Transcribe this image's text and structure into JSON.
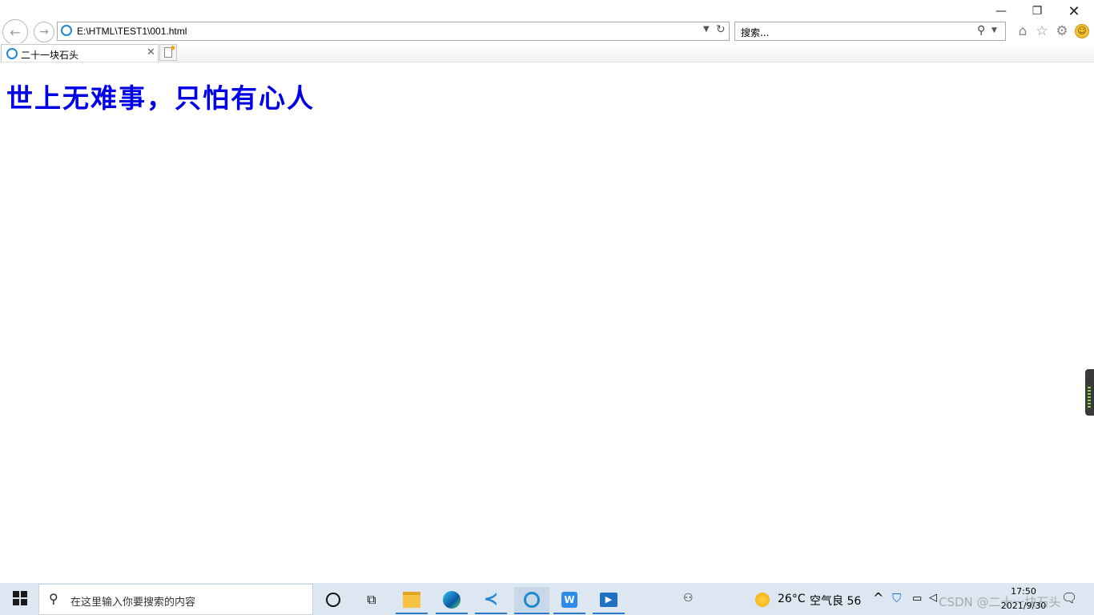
{
  "browser": {
    "address": "E:\\HTML\\TEST1\\001.html",
    "search_placeholder": "搜索...",
    "tab_title": "二十一块石头"
  },
  "content": {
    "heading": "世上无难事，只怕有心人"
  },
  "taskbar": {
    "search_placeholder": "在这里输入你要搜索的内容",
    "weather_temp": "26°C",
    "air_quality": "空气良 56",
    "time": "17:50",
    "date": "2021/9/30",
    "watermark": "CSDN @二十一块石头"
  },
  "colors": {
    "heading": "#0000e6",
    "taskbar": "#dce7f2",
    "accent": "#2a78c8"
  }
}
